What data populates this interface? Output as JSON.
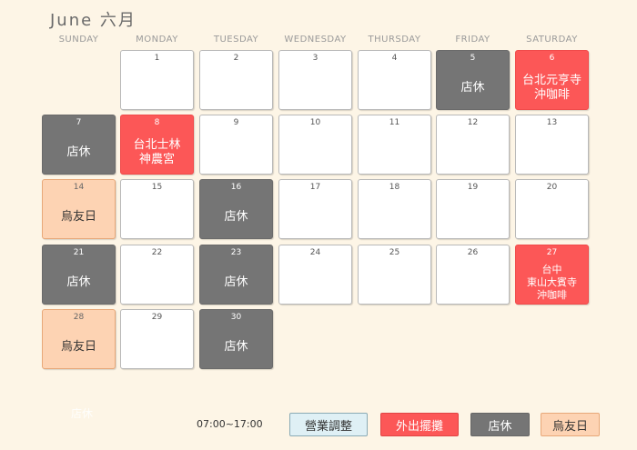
{
  "calendar": {
    "title": "June 六月",
    "weekdays": [
      "SUNDAY",
      "MONDAY",
      "TUESDAY",
      "WEDNESDAY",
      "THURSDAY",
      "FRIDAY",
      "SATURDAY"
    ],
    "start_offset": 1,
    "days": [
      {
        "day": "1",
        "type": "normal",
        "label": ""
      },
      {
        "day": "2",
        "type": "normal",
        "label": ""
      },
      {
        "day": "3",
        "type": "normal",
        "label": ""
      },
      {
        "day": "4",
        "type": "normal",
        "label": ""
      },
      {
        "day": "5",
        "type": "closed",
        "label": "店休"
      },
      {
        "day": "6",
        "type": "stall",
        "label": "台北元亨寺\n沖咖啡"
      },
      {
        "day": "7",
        "type": "closed",
        "label": "店休"
      },
      {
        "day": "8",
        "type": "stall",
        "label": "台北士林\n神農宮"
      },
      {
        "day": "9",
        "type": "normal",
        "label": ""
      },
      {
        "day": "10",
        "type": "normal",
        "label": ""
      },
      {
        "day": "11",
        "type": "normal",
        "label": ""
      },
      {
        "day": "12",
        "type": "normal",
        "label": ""
      },
      {
        "day": "13",
        "type": "normal",
        "label": ""
      },
      {
        "day": "14",
        "type": "wu",
        "label": "烏友日"
      },
      {
        "day": "15",
        "type": "normal",
        "label": ""
      },
      {
        "day": "16",
        "type": "closed",
        "label": "店休"
      },
      {
        "day": "17",
        "type": "normal",
        "label": ""
      },
      {
        "day": "18",
        "type": "normal",
        "label": ""
      },
      {
        "day": "19",
        "type": "normal",
        "label": ""
      },
      {
        "day": "20",
        "type": "normal",
        "label": ""
      },
      {
        "day": "21",
        "type": "closed",
        "label": "店休"
      },
      {
        "day": "22",
        "type": "normal",
        "label": ""
      },
      {
        "day": "23",
        "type": "closed",
        "label": "店休"
      },
      {
        "day": "24",
        "type": "normal",
        "label": ""
      },
      {
        "day": "25",
        "type": "normal",
        "label": ""
      },
      {
        "day": "26",
        "type": "normal",
        "label": ""
      },
      {
        "day": "27",
        "type": "stall",
        "label": "台中\n東山大賓寺\n沖咖啡"
      },
      {
        "day": "28",
        "type": "wu",
        "label": "烏友日"
      },
      {
        "day": "29",
        "type": "normal",
        "label": ""
      },
      {
        "day": "30",
        "type": "closed",
        "label": "店休"
      }
    ]
  },
  "footer": {
    "ghost_text": "店休",
    "hours": "07:00~17:00",
    "legend": [
      {
        "type": "adj",
        "label": "營業調整"
      },
      {
        "type": "stall",
        "label": "外出擺攤"
      },
      {
        "type": "closed",
        "label": "店休"
      },
      {
        "type": "wu",
        "label": "烏友日"
      }
    ]
  },
  "colors": {
    "background": "#fdf5e6",
    "closed": "#757575",
    "stall": "#fc5757",
    "wu_day": "#fdd3b3",
    "adjust": "#dff0f5"
  }
}
